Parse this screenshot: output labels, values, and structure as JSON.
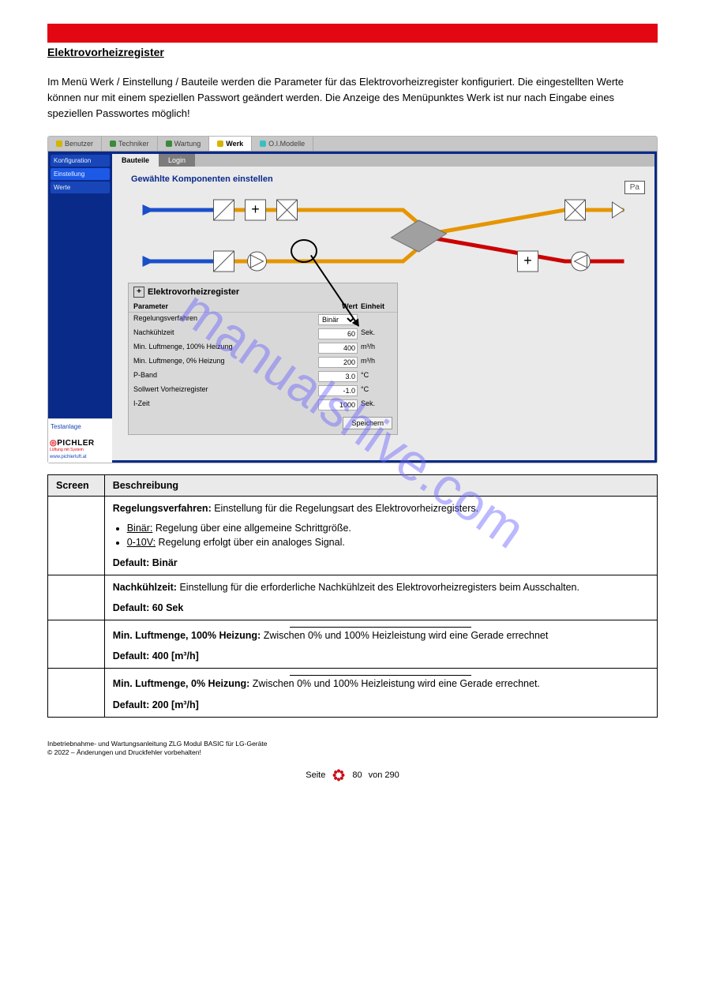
{
  "section_title": "Elektrovorheizregister",
  "intro": "Im Menü Werk / Einstellung / Bauteile werden die Parameter für das Elektrovorheizregister konfiguriert. Die eingestellten Werte können nur mit einem speziellen Passwort geändert werden. Die Anzeige des Menüpunktes Werk ist nur nach Eingabe eines speziellen Passwortes möglich!",
  "tabs_outer": [
    "Benutzer",
    "Techniker",
    "Wartung",
    "Werk",
    "O.I.Modelle"
  ],
  "sidebar": {
    "items": [
      "Konfiguration",
      "Einstellung",
      "Werte"
    ],
    "test": "Testanlage",
    "brand": "PICHLER",
    "tag": "Lüftung mit System",
    "url": "www.pichlerluft.at"
  },
  "inner_tabs": [
    "Bauteile",
    "Login"
  ],
  "canvas_title": "Gewählte Komponenten einstellen",
  "pa": "Pa",
  "panel": {
    "title": "Elektrovorheizregister",
    "header": {
      "p": "Parameter",
      "w": "Wert",
      "e": "Einheit"
    },
    "rows": [
      {
        "p": "Regelungsverfahren",
        "w": "Binär",
        "e": "",
        "select": true
      },
      {
        "p": "Nachkühlzeit",
        "w": "60",
        "e": "Sek."
      },
      {
        "p": "Min. Luftmenge, 100% Heizung",
        "w": "400",
        "e": "m³/h"
      },
      {
        "p": "Min. Luftmenge, 0% Heizung",
        "w": "200",
        "e": "m³/h"
      },
      {
        "p": "P-Band",
        "w": "3.0",
        "e": "°C"
      },
      {
        "p": "Sollwert Vorheizregister",
        "w": "-1.0",
        "e": "°C"
      },
      {
        "p": "I-Zeit",
        "w": "1000",
        "e": "Sek."
      }
    ],
    "save": "Speichern"
  },
  "doc_table": {
    "h1": "Screen",
    "h2": "Beschreibung",
    "rows": [
      {
        "label": "Regelungsverfahren:",
        "text": "Einstellung für die Regelungsart des Elektrovorheizregisters.",
        "bullets": [
          {
            "u": "Binär:",
            "t": " Regelung über eine allgemeine Schrittgröße."
          },
          {
            "u": "0-10V:",
            "t": " Regelung erfolgt über ein analoges Signal."
          }
        ],
        "def": "Default: Binär"
      },
      {
        "label": "Nachkühlzeit:",
        "text": "Einstellung für die erforderliche Nachkühlzeit des Elektrovorheizregisters beim Ausschalten.",
        "def": "Default: 60 Sek"
      },
      {
        "deco": true,
        "label": "Min. Luftmenge, 100% Heizung:",
        "text": "Zwischen 0% und 100% Heizleistung wird eine Gerade errechnet",
        "def": "Default: 400 [m³/h]"
      },
      {
        "deco": true,
        "label": "Min. Luftmenge, 0% Heizung:",
        "text": "Zwischen 0% und 100% Heizleistung wird eine Gerade errechnet.",
        "def": "Default: 200 [m³/h]"
      }
    ]
  },
  "footnote": "Inbetriebnahme- und Wartungsanleitung ZLG Modul BASIC für LG-Geräte\n© 2022 – Änderungen und Druckfehler vorbehalten!",
  "page_left": "Seite",
  "page_num": "80",
  "page_right": "von 290",
  "watermark": "manualshive.com"
}
